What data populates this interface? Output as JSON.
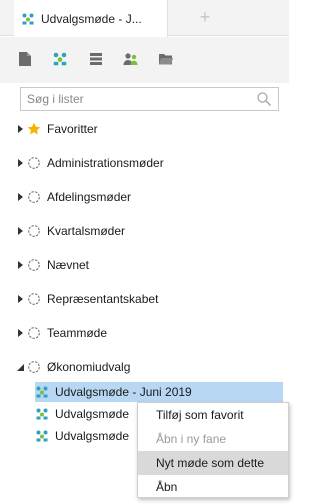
{
  "tabs": {
    "active_label": "Udvalgsmøde - J...",
    "add_symbol": "+"
  },
  "toolbar": {
    "buttons": [
      {
        "name": "new-document-button",
        "icon": "document-icon"
      },
      {
        "name": "new-meeting-button",
        "icon": "meeting-icon"
      },
      {
        "name": "list-button",
        "icon": "list-icon"
      },
      {
        "name": "participants-button",
        "icon": "people-icon"
      },
      {
        "name": "open-folder-button",
        "icon": "folder-icon"
      }
    ]
  },
  "search": {
    "placeholder": "Søg i lister"
  },
  "tree": {
    "favorites": "Favoritter",
    "groups": [
      "Administrationsmøder",
      "Afdelingsmøder",
      "Kvartalsmøder",
      "Nævnet",
      "Repræsentantskabet",
      "Teammøde"
    ],
    "expanded_group": "Økonomiudvalg",
    "children": [
      "Udvalgsmøde - Juni 2019",
      "Udvalgsmøde",
      "Udvalgsmøde"
    ]
  },
  "context_menu": {
    "items": [
      "Tilføj som favorit",
      "Åbn i ny fane",
      "Nyt møde som dette",
      "Åbn"
    ]
  },
  "colors": {
    "selection": "#b8d7f3",
    "favorite_star": "#f5b400",
    "meeting_icon": "#2ea1c2",
    "toolbar_icon": "#6b6b6b"
  }
}
